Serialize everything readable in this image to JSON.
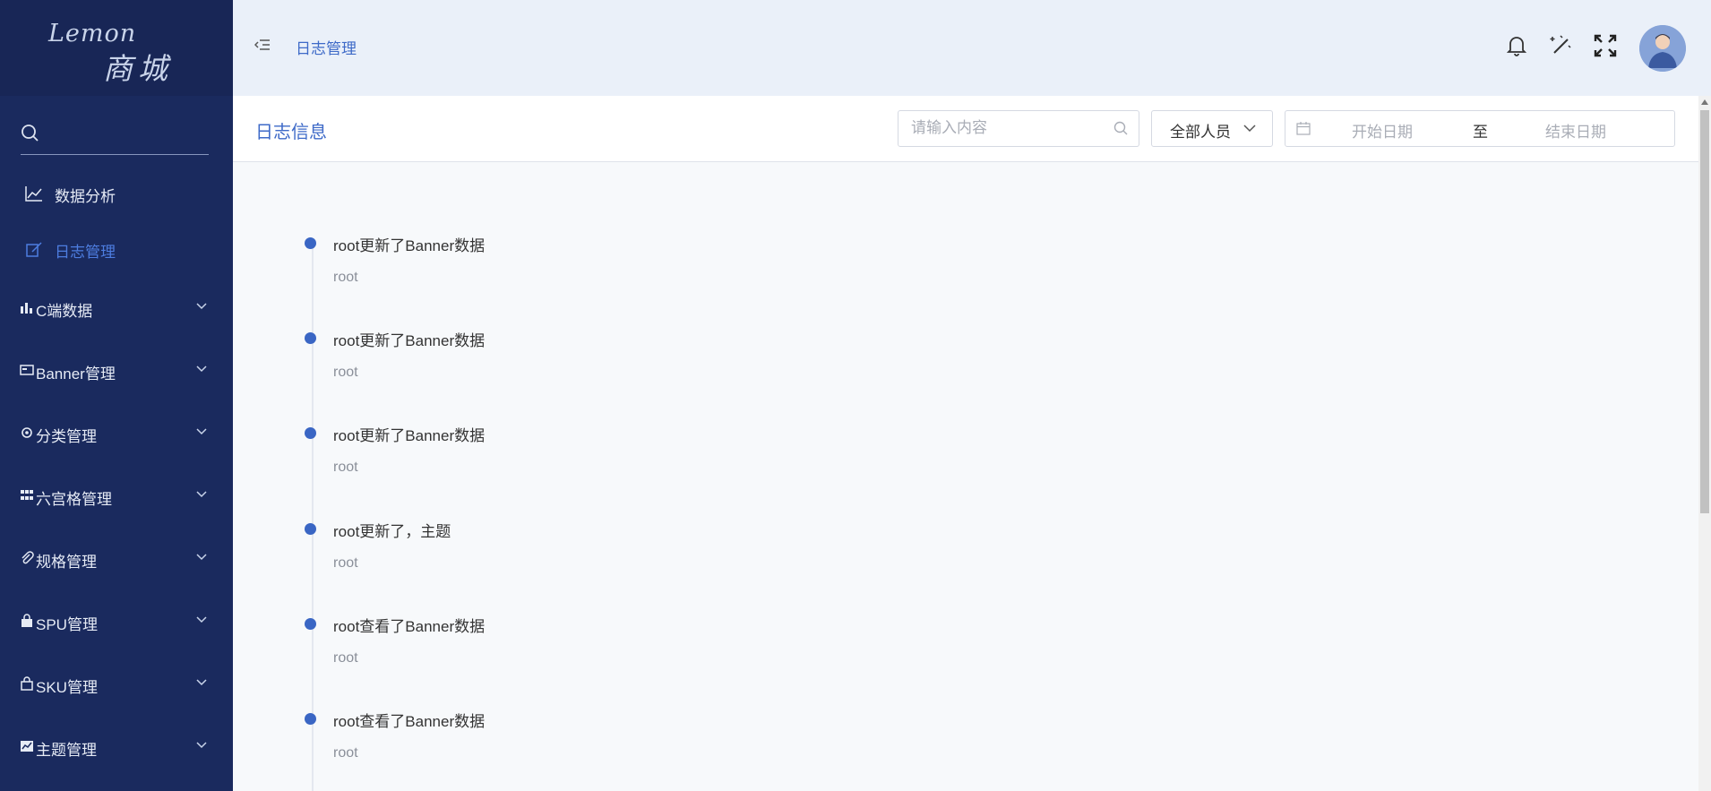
{
  "logo": {
    "line1": "Lemon",
    "line2": "商城"
  },
  "sidebar": {
    "search_placeholder": "",
    "items": [
      {
        "label": "数据分析",
        "icon": "chart-line-icon",
        "active": false
      },
      {
        "label": "日志管理",
        "icon": "edit-log-icon",
        "active": true
      }
    ],
    "groups": [
      {
        "label": "C端数据",
        "icon": "bar-chart-icon"
      },
      {
        "label": "Banner管理",
        "icon": "banner-icon"
      },
      {
        "label": "分类管理",
        "icon": "category-icon"
      },
      {
        "label": "六宫格管理",
        "icon": "grid-icon"
      },
      {
        "label": "规格管理",
        "icon": "paperclip-icon"
      },
      {
        "label": "SPU管理",
        "icon": "bag-icon"
      },
      {
        "label": "SKU管理",
        "icon": "shopping-bag-icon"
      },
      {
        "label": "主题管理",
        "icon": "theme-icon"
      }
    ]
  },
  "header": {
    "breadcrumb": "日志管理"
  },
  "panel": {
    "title": "日志信息",
    "search_placeholder": "请输入内容",
    "user_filter": "全部人员",
    "date_start_placeholder": "开始日期",
    "date_separator": "至",
    "date_end_placeholder": "结束日期"
  },
  "logs": [
    {
      "title": "root更新了Banner数据",
      "user": "root"
    },
    {
      "title": "root更新了Banner数据",
      "user": "root"
    },
    {
      "title": "root更新了Banner数据",
      "user": "root"
    },
    {
      "title": "root更新了，主题",
      "user": "root"
    },
    {
      "title": "root查看了Banner数据",
      "user": "root"
    },
    {
      "title": "root查看了Banner数据",
      "user": "root"
    }
  ],
  "colors": {
    "sidebar": "#1a2a5e",
    "accent": "#3e6ac8",
    "header": "#eaf0f9"
  }
}
